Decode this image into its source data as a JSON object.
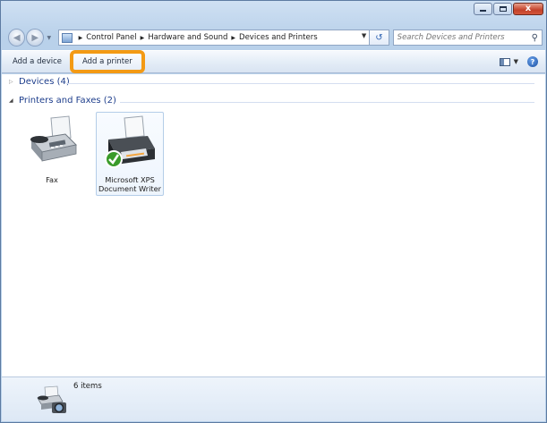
{
  "window": {
    "caption_close": "x"
  },
  "address": {
    "crumbs": [
      "Control Panel",
      "Hardware and Sound",
      "Devices and Printers"
    ]
  },
  "search": {
    "placeholder": "Search Devices and Printers"
  },
  "toolbar": {
    "add_device_label": "Add a device",
    "add_printer_label": "Add a printer",
    "highlight_color": "#f39a14"
  },
  "groups": {
    "devices": {
      "label": "Devices (4)",
      "expanded": false
    },
    "printers": {
      "label": "Printers and Faxes (2)",
      "expanded": true
    }
  },
  "printers": [
    {
      "name": "Fax",
      "icon": "fax-icon",
      "default": false,
      "selected": false
    },
    {
      "name": "Microsoft XPS Document Writer",
      "icon": "printer-icon",
      "default": true,
      "selected": true
    }
  ],
  "status": {
    "items_count": "6 items",
    "icon": "printer-camera-icon"
  }
}
